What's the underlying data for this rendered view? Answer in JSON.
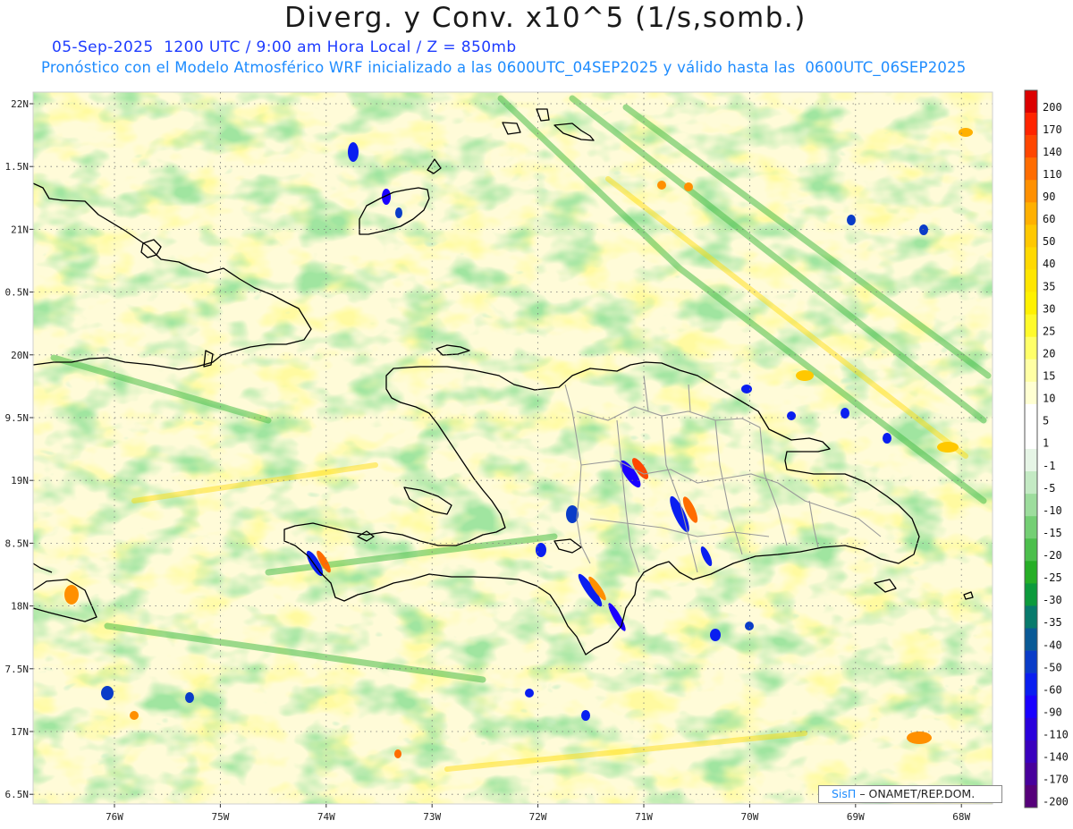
{
  "header": {
    "title": "Diverg. y Conv. x10^5 (1/s,somb.)",
    "subtitle": "05-Sep-2025  1200 UTC / 9:00 am Hora Local / Z = 850mb",
    "forecast": "Pronóstico con el Modelo Atmosférico WRF inicializado a las 0600UTC_04SEP2025 y válido hasta las  0600UTC_06SEP2025"
  },
  "axes": {
    "lat_labels": [
      "22N",
      "1.5N",
      "21N",
      "0.5N",
      "20N",
      "9.5N",
      "19N",
      "8.5N",
      "18N",
      "7.5N",
      "17N",
      "6.5N"
    ],
    "lon_labels": [
      "76W",
      "75W",
      "74W",
      "73W",
      "72W",
      "71W",
      "70W",
      "69W",
      "68W"
    ]
  },
  "colorbar": {
    "labels": [
      "200",
      "170",
      "140",
      "110",
      "90",
      "60",
      "50",
      "40",
      "35",
      "30",
      "25",
      "20",
      "15",
      "10",
      "5",
      "1",
      "-1",
      "-5",
      "-10",
      "-15",
      "-20",
      "-25",
      "-30",
      "-35",
      "-40",
      "-50",
      "-60",
      "-90",
      "-110",
      "-140",
      "-170",
      "-200"
    ],
    "colors": [
      "#dc0000",
      "#ff2400",
      "#ff4600",
      "#ff6c00",
      "#ff9000",
      "#ffb000",
      "#ffc800",
      "#ffd900",
      "#ffe600",
      "#fff100",
      "#fffa2a",
      "#ffff68",
      "#ffffa4",
      "#ffffd2",
      "#ffffff",
      "#ffffff",
      "#e6f5e6",
      "#c4eac4",
      "#9ddd9d",
      "#74cf74",
      "#4cbf4c",
      "#26ae26",
      "#0c9a3c",
      "#087a6c",
      "#0a5a96",
      "#0a3cc8",
      "#0a1ef0",
      "#1a00ff",
      "#2a00dc",
      "#3a00be",
      "#48009c",
      "#56007a"
    ]
  },
  "credit": {
    "brand": "SisΠ",
    "text": "– ONAMET/REP.DOM."
  }
}
